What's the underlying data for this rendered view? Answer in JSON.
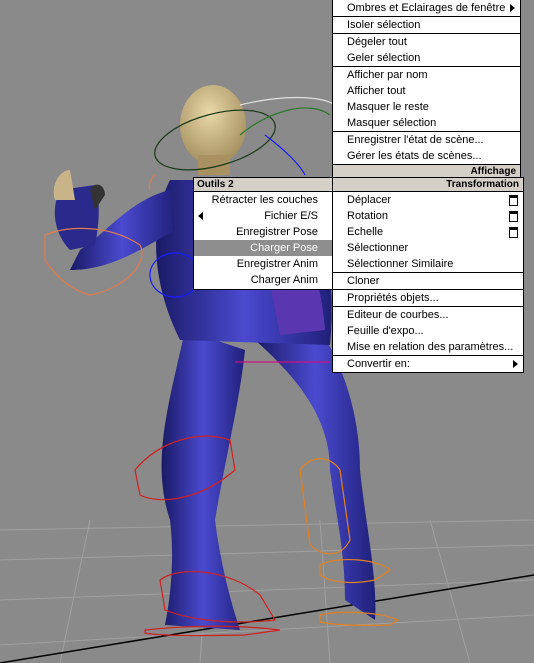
{
  "quad_right": {
    "items": [
      {
        "label": "Ombres et Eclairages de fenêtre",
        "submenu": true
      },
      {
        "label": "Isoler sélection"
      },
      {
        "label": "Dégeler tout"
      },
      {
        "label": "Geler sélection"
      },
      {
        "label": "Afficher par nom"
      },
      {
        "label": "Afficher tout"
      },
      {
        "label": "Masquer le reste"
      },
      {
        "label": "Masquer sélection"
      },
      {
        "label": "Enregistrer l'état de scène..."
      },
      {
        "label": "Gérer les états de scènes..."
      }
    ],
    "header_affichage": "Affichage",
    "header_transformation": "Transformation",
    "transform_items": [
      {
        "label": "Déplacer",
        "has_settings": true
      },
      {
        "label": "Rotation",
        "has_settings": true
      },
      {
        "label": "Echelle",
        "has_settings": true
      },
      {
        "label": "Sélectionner"
      },
      {
        "label": "Sélectionner Similaire"
      },
      {
        "label": "Cloner"
      },
      {
        "label": "Propriétés objets..."
      },
      {
        "label": "Editeur de courbes..."
      },
      {
        "label": "Feuille d'expo..."
      },
      {
        "label": "Mise en relation des paramètres..."
      },
      {
        "label": "Convertir en:",
        "submenu": true
      }
    ]
  },
  "quad_left": {
    "header": "Outils 2",
    "items": [
      {
        "label": "Rétracter les couches"
      },
      {
        "label": "Fichier E/S",
        "submenu": true
      },
      {
        "label": "Enregistrer Pose"
      },
      {
        "label": "Charger Pose",
        "highlighted": true
      },
      {
        "label": "Enregistrer Anim"
      },
      {
        "label": "Charger Anim"
      }
    ]
  },
  "colors": {
    "viewport_bg": "#8a8a8a",
    "menu_bg": "#ffffff",
    "header_bg": "#d4d0c8",
    "highlight": "#8e8e8e",
    "body_suit": "#2a2a8c",
    "skin": "#c9b48a"
  }
}
